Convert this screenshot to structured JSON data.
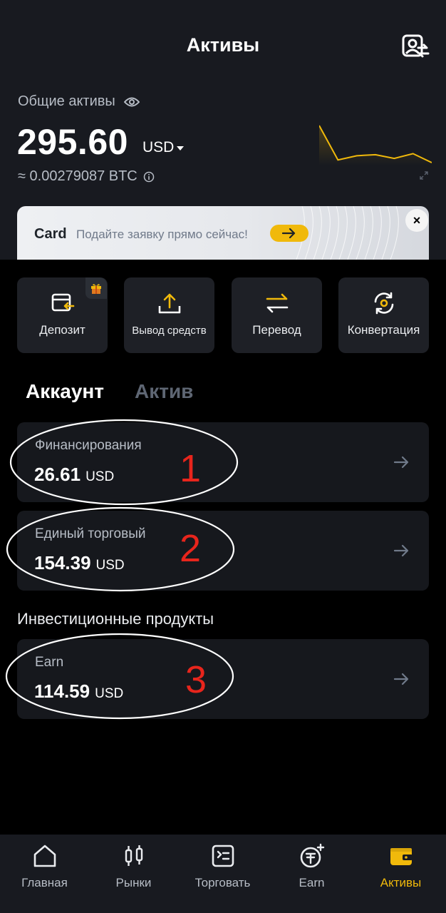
{
  "header": {
    "title": "Активы",
    "icon": "user-switch-icon"
  },
  "overview": {
    "label": "Общие активы",
    "eye_icon": "eye-icon",
    "total": "295.60",
    "currency": "USD",
    "btc_equivalent": "≈ 0.00279087 BTC",
    "sparkline_values": [
      95,
      30,
      38,
      40,
      33,
      42,
      25
    ]
  },
  "banner": {
    "title": "Card",
    "subtitle": "Подайте заявку прямо сейчас!",
    "go_icon": "arrow-right-icon",
    "close_label": "×"
  },
  "actions": [
    {
      "label": "Депозит",
      "icon": "deposit-card-icon",
      "has_gift": true
    },
    {
      "label": "Вывод средств",
      "icon": "upload-icon",
      "has_gift": false
    },
    {
      "label": "Перевод",
      "icon": "transfer-icon",
      "has_gift": false
    },
    {
      "label": "Конвертация",
      "icon": "convert-icon",
      "has_gift": false
    }
  ],
  "tabs": [
    {
      "label": "Аккаунт",
      "active": true
    },
    {
      "label": "Актив",
      "active": false
    }
  ],
  "accounts": [
    {
      "title": "Финансирования",
      "amount": "26.61",
      "currency": "USD",
      "mark": "1"
    },
    {
      "title": "Единый торговый",
      "amount": "154.39",
      "currency": "USD",
      "mark": "2"
    }
  ],
  "investment_section": {
    "label": "Инвестиционные продукты",
    "items": [
      {
        "title": "Earn",
        "amount": "114.59",
        "currency": "USD",
        "mark": "3"
      }
    ]
  },
  "colors": {
    "accent": "#f0b90b",
    "annotation": "#e8251c",
    "card_bg": "#16181d"
  },
  "nav": [
    {
      "label": "Главная",
      "icon": "home-icon",
      "active": false
    },
    {
      "label": "Рынки",
      "icon": "candlestick-icon",
      "active": false
    },
    {
      "label": "Торговать",
      "icon": "trade-icon",
      "active": false
    },
    {
      "label": "Earn",
      "icon": "earn-coin-icon",
      "active": false
    },
    {
      "label": "Активы",
      "icon": "wallet-icon",
      "active": true
    }
  ]
}
